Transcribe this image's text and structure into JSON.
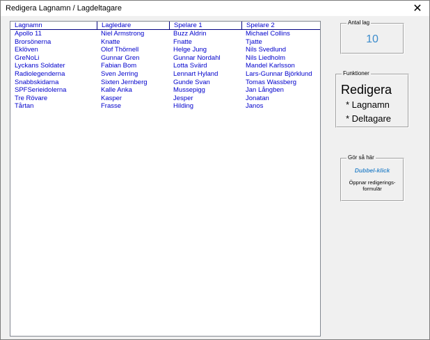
{
  "window": {
    "title": "Redigera Lagnamn / Lagdeltagare",
    "close_glyph": "✕"
  },
  "list": {
    "columns": [
      "Lagnamn",
      "Lagledare",
      "Spelare 1",
      "Spelare 2"
    ],
    "rows": [
      [
        "Apollo 11",
        "Niel Armstrong",
        "Buzz Aldrin",
        "Michael Collins"
      ],
      [
        "Brorsönerna",
        "Knatte",
        "Fnatte",
        "Tjatte"
      ],
      [
        "Eklöven",
        "Olof Thörnell",
        "Helge Jung",
        "Nils Svedlund"
      ],
      [
        "GreNoLi",
        "Gunnar Gren",
        "Gunnar Nordahl",
        "Nils Liedholm"
      ],
      [
        "Lyckans Soldater",
        "Fabian Bom",
        "Lotta Svärd",
        "Mandel Karlsson"
      ],
      [
        "Radiolegenderna",
        "Sven Jerring",
        "Lennart Hyland",
        "Lars-Gunnar Björklund"
      ],
      [
        "Snabbskidarna",
        "Sixten Jernberg",
        "Gunde Svan",
        "Tomas Wassberg"
      ],
      [
        "SPFSerieidolerna",
        "Kalle Anka",
        "Mussepigg",
        "Jan Långben"
      ],
      [
        "Tre Rövare",
        "Kasper",
        "Jesper",
        "Jonatan"
      ],
      [
        "Tårtan",
        "Frasse",
        "Hilding",
        "Janos"
      ]
    ]
  },
  "count_panel": {
    "caption": "Antal lag",
    "value": "10"
  },
  "functions_panel": {
    "caption": "Funktioner",
    "title": "Redigera",
    "items": [
      "* Lagnamn",
      "* Deltagare"
    ]
  },
  "help_panel": {
    "caption": "Gör så här",
    "action": "Dubbel-klick",
    "description": "Öppnar redigerings-formulär"
  },
  "colors": {
    "list_text": "#0000cc",
    "accent": "#3c8ccc"
  }
}
